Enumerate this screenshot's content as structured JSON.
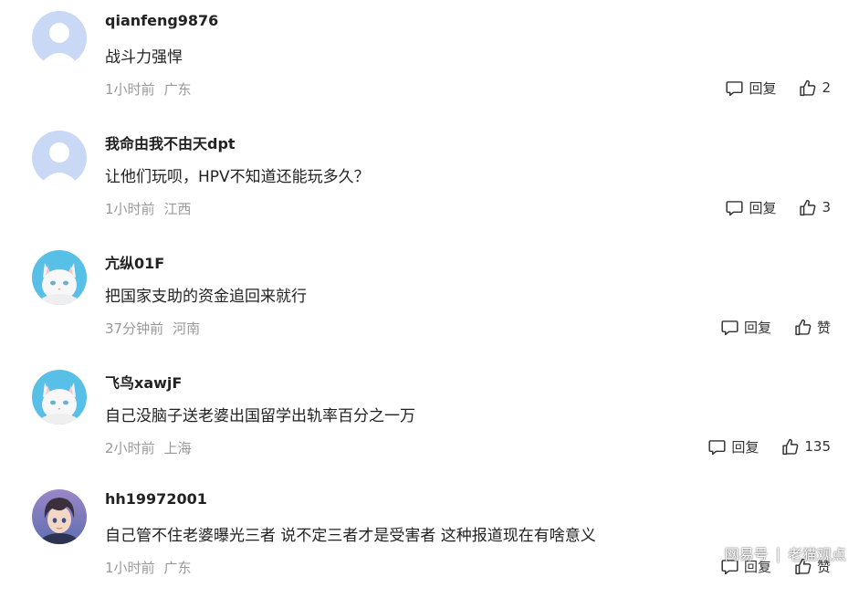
{
  "comments": [
    {
      "username": "qianfeng9876",
      "text": "战斗力强悍",
      "time": "1小时前",
      "location": "广东",
      "reply_label": "回复",
      "like_label": "2"
    },
    {
      "username": "我命由我不由天dpt",
      "text": "让他们玩呗，HPV不知道还能玩多久？",
      "time": "1小时前",
      "location": "江西",
      "reply_label": "回复",
      "like_label": "3"
    },
    {
      "username": "亢纵01F",
      "text": "把国家支助的资金追回来就行",
      "time": "37分钟前",
      "location": "河南",
      "reply_label": "回复",
      "like_label": "赞"
    },
    {
      "username": "飞鸟xawjF",
      "text": "自己没脑子送老婆出国留学出轨率百分之一万",
      "time": "2小时前",
      "location": "上海",
      "reply_label": "回复",
      "like_label": "135"
    },
    {
      "username": "hh19972001",
      "text": "自己管不住老婆曝光三者 说不定三者才是受害者 这种报道现在有啥意义",
      "time": "1小时前",
      "location": "广东",
      "reply_label": "回复",
      "like_label": "赞"
    }
  ],
  "icons": {
    "avatars": [
      "default-avatar-icon",
      "default-avatar-icon",
      "white-cat-avatar",
      "white-cat-avatar",
      "anime-boy-avatar"
    ],
    "reply": "comment-bubble-icon",
    "like": "thumbs-up-icon"
  },
  "watermark": {
    "brand": "网易号",
    "separator": "|",
    "author": "老猫观点"
  },
  "colors": {
    "text": "#222222",
    "meta": "#999999",
    "action": "#333333",
    "default_avatar_bg": "#c9d9f5",
    "cat_avatar_bg": "#58bfe6"
  }
}
